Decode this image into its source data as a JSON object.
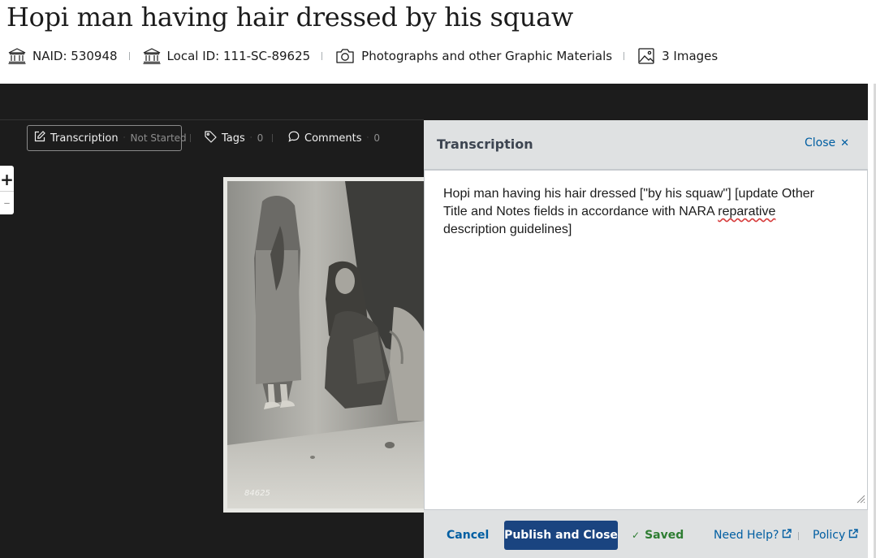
{
  "record": {
    "title": "Hopi man having hair dressed by his squaw",
    "meta": [
      {
        "icon": "institution-icon",
        "label": "NAID: 530948"
      },
      {
        "icon": "institution-icon",
        "label": "Local ID: 111-SC-89625"
      },
      {
        "icon": "camera-icon",
        "label": "Photographs and other Graphic Materials"
      },
      {
        "icon": "image-icon",
        "label": "3 Images"
      }
    ]
  },
  "toolbar": {
    "transcription_label": "Transcription",
    "transcription_status": "Not Started",
    "tags_label": "Tags",
    "tags_count": "0",
    "comments_label": "Comments",
    "comments_count": "0"
  },
  "zoom": {
    "in_label": "+",
    "out_label": "–"
  },
  "photo": {
    "caption": "84625"
  },
  "panel": {
    "title": "Transcription",
    "close_label": "Close",
    "text_part1": "Hopi man having his hair dressed [\"by his squaw\"] [update Other Title and Notes fields in accordance with NARA ",
    "text_misspelled": "reparative",
    "text_part2": " description guidelines]",
    "cancel_label": "Cancel",
    "publish_label": "Publish and Close",
    "saved_label": "Saved",
    "help_label": "Need Help?",
    "policy_label": "Policy"
  },
  "colors": {
    "link": "#005ea2",
    "primary_button": "#1a4480",
    "saved_green": "#2e7d32",
    "viewer_bg": "#1c1c1c",
    "panel_bg": "#dfe1e2"
  }
}
